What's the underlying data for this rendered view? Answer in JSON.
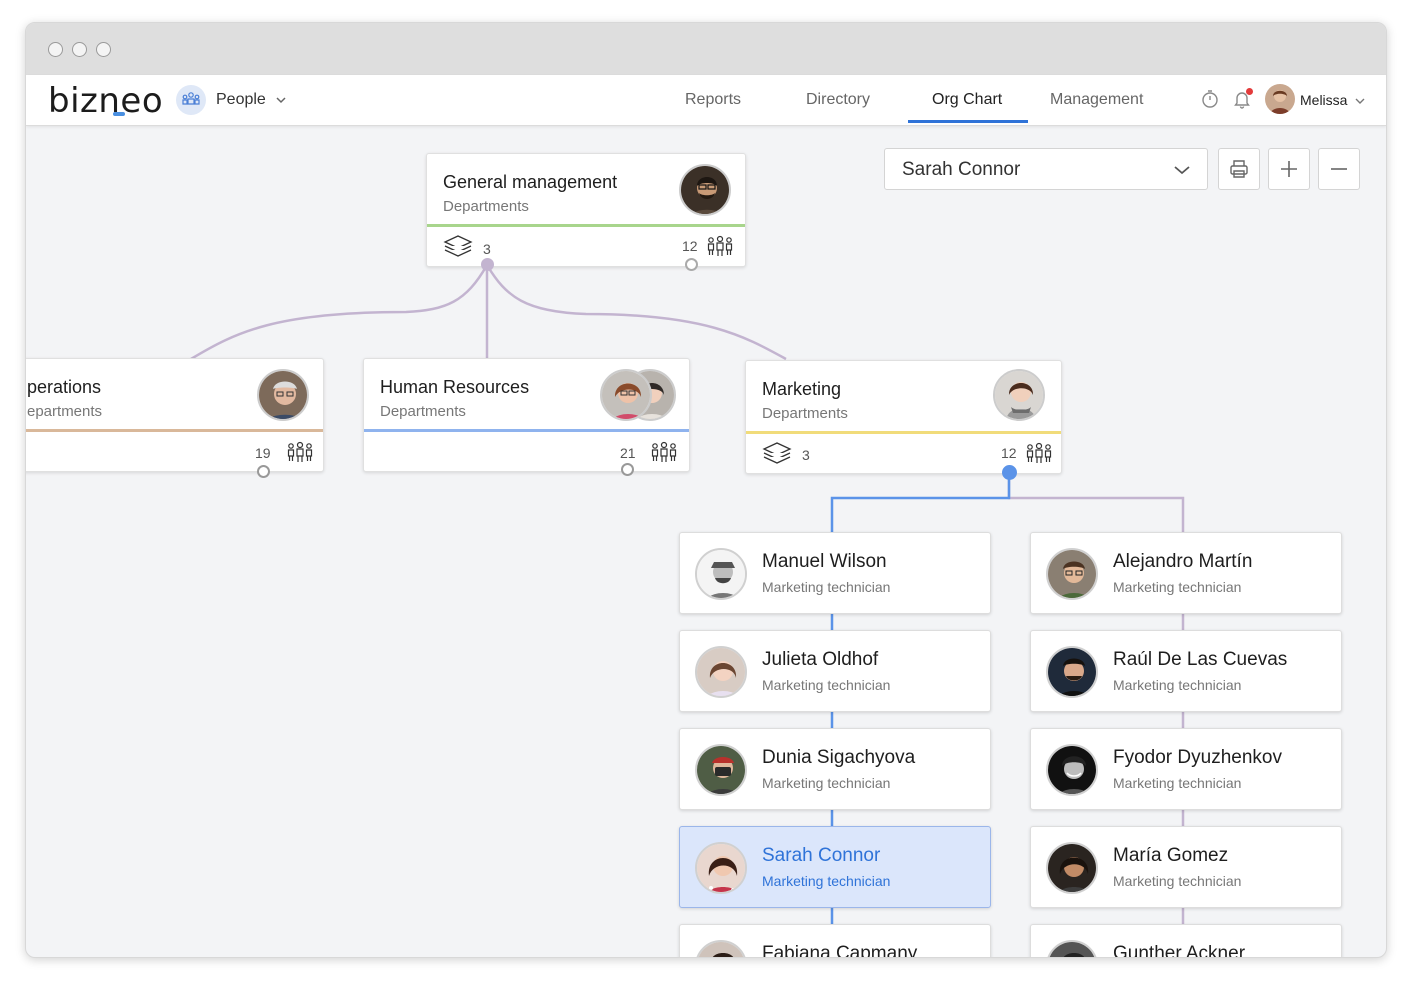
{
  "app": {
    "logo_text": "bizneo",
    "module_label": "People"
  },
  "nav": {
    "items": [
      {
        "label": "Reports"
      },
      {
        "label": "Directory"
      },
      {
        "label": "Org Chart"
      },
      {
        "label": "Management"
      }
    ],
    "active": "Org Chart"
  },
  "user": {
    "name": "Melissa"
  },
  "toolbar": {
    "search_value": "Sarah Connor",
    "print_icon": "printer-icon",
    "zoom_in_icon": "plus-icon",
    "zoom_out_icon": "minus-icon"
  },
  "departments": [
    {
      "title": "General management",
      "subtitle": "Departments",
      "sub_count": "3",
      "people_count": "12",
      "color": "#a8d58c"
    },
    {
      "title": "perations",
      "subtitle": "epartments",
      "people_count": "19",
      "color": "#d9b89a"
    },
    {
      "title": "Human Resources",
      "subtitle": "Departments",
      "people_count": "21",
      "color": "#8fb3ee"
    },
    {
      "title": "Marketing",
      "subtitle": "Departments",
      "sub_count": "3",
      "people_count": "12",
      "color": "#f1dc7a"
    }
  ],
  "people": [
    {
      "name": "Manuel Wilson",
      "role": "Marketing technician"
    },
    {
      "name": "Alejandro Martín",
      "role": "Marketing technician"
    },
    {
      "name": "Julieta Oldhof",
      "role": "Marketing technician"
    },
    {
      "name": "Raúl De Las Cuevas",
      "role": "Marketing technician"
    },
    {
      "name": "Dunia Sigachyova",
      "role": "Marketing technician"
    },
    {
      "name": "Fyodor Dyuzhenkov",
      "role": "Marketing technician"
    },
    {
      "name": "Sarah Connor",
      "role": "Marketing technician"
    },
    {
      "name": "María Gomez",
      "role": "Marketing technician"
    },
    {
      "name": "Fabiana Capmany",
      "role": ""
    },
    {
      "name": "Gunther Ackner",
      "role": ""
    }
  ],
  "colors": {
    "accent": "#2f73d8",
    "connector": "#c3b4d0",
    "selected_bg": "#dbe6fb"
  }
}
